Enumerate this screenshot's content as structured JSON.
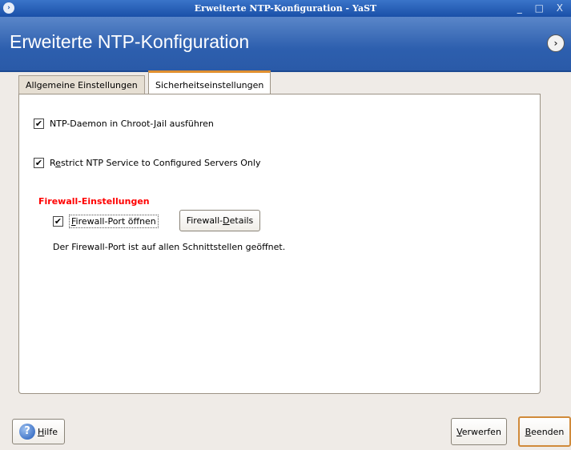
{
  "window": {
    "title": "Erweiterte NTP-Konfiguration - YaST",
    "minimize": "_",
    "maximize": "□",
    "close": "X"
  },
  "header": {
    "title": "Erweiterte NTP-Konfiguration",
    "help_icon": "arrow-circle-icon"
  },
  "tabs": [
    {
      "label": "Allgemeine Einstellungen",
      "active": false
    },
    {
      "label": "Sicherheitseinstellungen",
      "active": true
    }
  ],
  "options": {
    "chroot": {
      "pre": "NTP-Daemon in Chroot-",
      "key": "J",
      "post": "ail ausführen",
      "checked": true
    },
    "restrict": {
      "pre": "R",
      "key": "e",
      "post": "strict NTP Service to Configured Servers Only",
      "checked": true
    }
  },
  "firewall": {
    "heading": "Firewall-Einstellungen",
    "port": {
      "key": "F",
      "post": "irewall-Port öffnen",
      "checked": true
    },
    "details_button": {
      "pre": "Firewall-",
      "key": "D",
      "post": "etails"
    },
    "status": "Der Firewall-Port ist auf allen Schnittstellen geöffnet."
  },
  "buttons": {
    "help": {
      "key": "H",
      "post": "ilfe",
      "icon": "help-icon"
    },
    "discard": {
      "key": "V",
      "post": "erwerfen"
    },
    "finish": {
      "key": "B",
      "post": "eenden"
    }
  },
  "check_mark": "✔"
}
